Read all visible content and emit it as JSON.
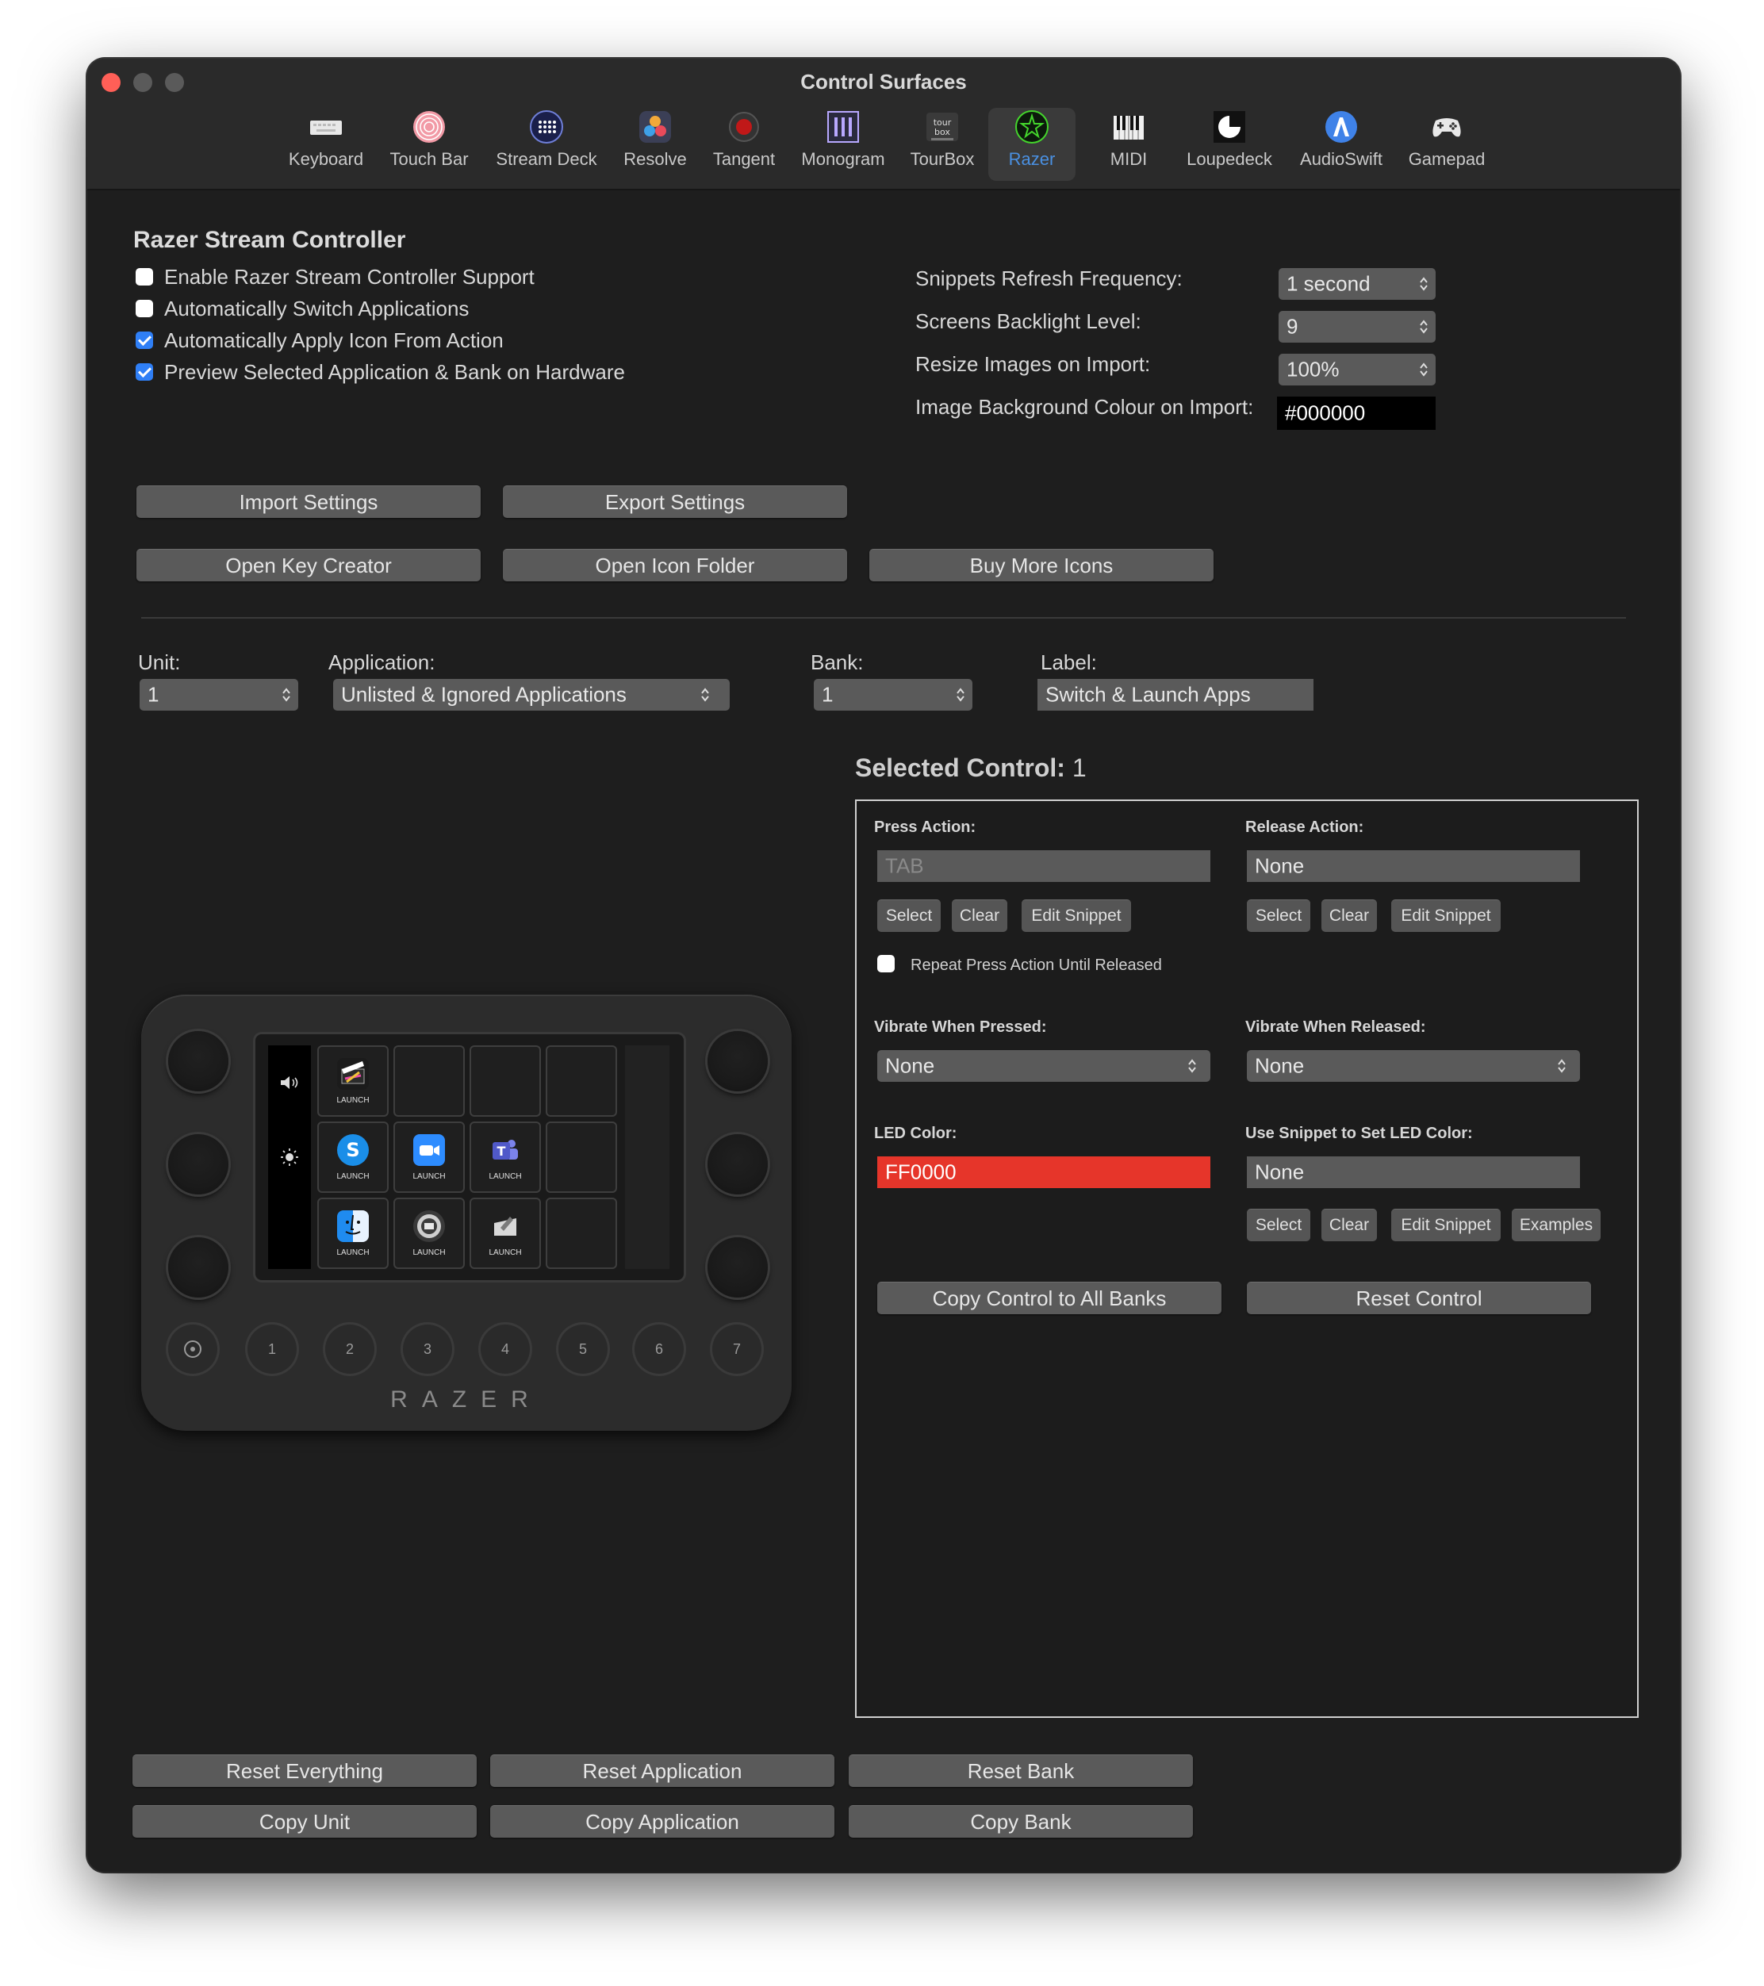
{
  "window": {
    "title": "Control Surfaces"
  },
  "toolbar": {
    "items": [
      {
        "label": "Keyboard",
        "icon": "keyboard-icon"
      },
      {
        "label": "Touch Bar",
        "icon": "touch-bar-icon"
      },
      {
        "label": "Stream Deck",
        "icon": "stream-deck-icon"
      },
      {
        "label": "Resolve",
        "icon": "resolve-icon"
      },
      {
        "label": "Tangent",
        "icon": "tangent-icon"
      },
      {
        "label": "Monogram",
        "icon": "monogram-icon"
      },
      {
        "label": "TourBox",
        "icon": "tourbox-icon"
      },
      {
        "label": "Razer",
        "icon": "razer-icon",
        "selected": true
      },
      {
        "label": "MIDI",
        "icon": "midi-icon"
      },
      {
        "label": "Loupedeck",
        "icon": "loupedeck-icon"
      },
      {
        "label": "AudioSwift",
        "icon": "audioswift-icon"
      },
      {
        "label": "Gamepad",
        "icon": "gamepad-icon"
      }
    ]
  },
  "settings": {
    "heading": "Razer Stream Controller",
    "checkboxes": [
      {
        "label": "Enable Razer Stream Controller Support",
        "checked": false
      },
      {
        "label": "Automatically Switch Applications",
        "checked": false
      },
      {
        "label": "Automatically Apply Icon From Action",
        "checked": true
      },
      {
        "label": "Preview Selected Application & Bank on Hardware",
        "checked": true
      }
    ],
    "snippets_label": "Snippets Refresh Frequency:",
    "snippets_value": "1 second",
    "backlight_label": "Screens Backlight Level:",
    "backlight_value": "9",
    "resize_label": "Resize Images on Import:",
    "resize_value": "100%",
    "bgcolour_label": "Image Background Colour on Import:",
    "bgcolour_value": "#000000",
    "buttons": {
      "import": "Import Settings",
      "export": "Export Settings",
      "key_creator": "Open Key Creator",
      "icon_folder": "Open Icon Folder",
      "buy_icons": "Buy More Icons"
    }
  },
  "selectors": {
    "unit_label": "Unit:",
    "unit_value": "1",
    "application_label": "Application:",
    "application_value": "Unlisted & Ignored Applications",
    "bank_label": "Bank:",
    "bank_value": "1",
    "label_label": "Label:",
    "label_value": "Switch & Launch Apps"
  },
  "device": {
    "brand": "RAZER",
    "round_buttons": [
      "1",
      "2",
      "3",
      "4",
      "5",
      "6",
      "7"
    ],
    "key_label": "LAUNCH",
    "keys": [
      {
        "icon": "final-cut-icon",
        "label": "LAUNCH"
      },
      {
        "icon": "skype-icon",
        "label": "LAUNCH"
      },
      {
        "icon": "zoom-icon",
        "label": "LAUNCH"
      },
      {
        "icon": "teams-icon",
        "label": "LAUNCH"
      },
      {
        "icon": "finder-icon",
        "label": "LAUNCH"
      },
      {
        "icon": "compressor-icon",
        "label": "LAUNCH"
      },
      {
        "icon": "motion-icon",
        "label": "LAUNCH"
      }
    ]
  },
  "selected_control": {
    "title": "Selected Control:",
    "value": "1",
    "press_label": "Press Action:",
    "press_value": "TAB",
    "release_label": "Release Action:",
    "release_value": "None",
    "select": "Select",
    "clear": "Clear",
    "edit_snippet": "Edit Snippet",
    "examples": "Examples",
    "repeat_label": "Repeat Press Action Until Released",
    "vibrate_pressed_label": "Vibrate When Pressed:",
    "vibrate_pressed_value": "None",
    "vibrate_released_label": "Vibrate When Released:",
    "vibrate_released_value": "None",
    "led_label": "LED Color:",
    "led_value": "FF0000",
    "led_color": "#e6352a",
    "snippet_led_label": "Use Snippet to Set LED Color:",
    "snippet_led_value": "None",
    "copy_all_banks": "Copy Control to All Banks",
    "reset_control": "Reset Control"
  },
  "footer": {
    "reset_everything": "Reset Everything",
    "reset_application": "Reset Application",
    "reset_bank": "Reset Bank",
    "copy_unit": "Copy Unit",
    "copy_application": "Copy Application",
    "copy_bank": "Copy Bank"
  },
  "colors": {
    "accent": "#4a90e2",
    "checkbox_on": "#2f7ff6",
    "razer_green": "#44d62c"
  }
}
